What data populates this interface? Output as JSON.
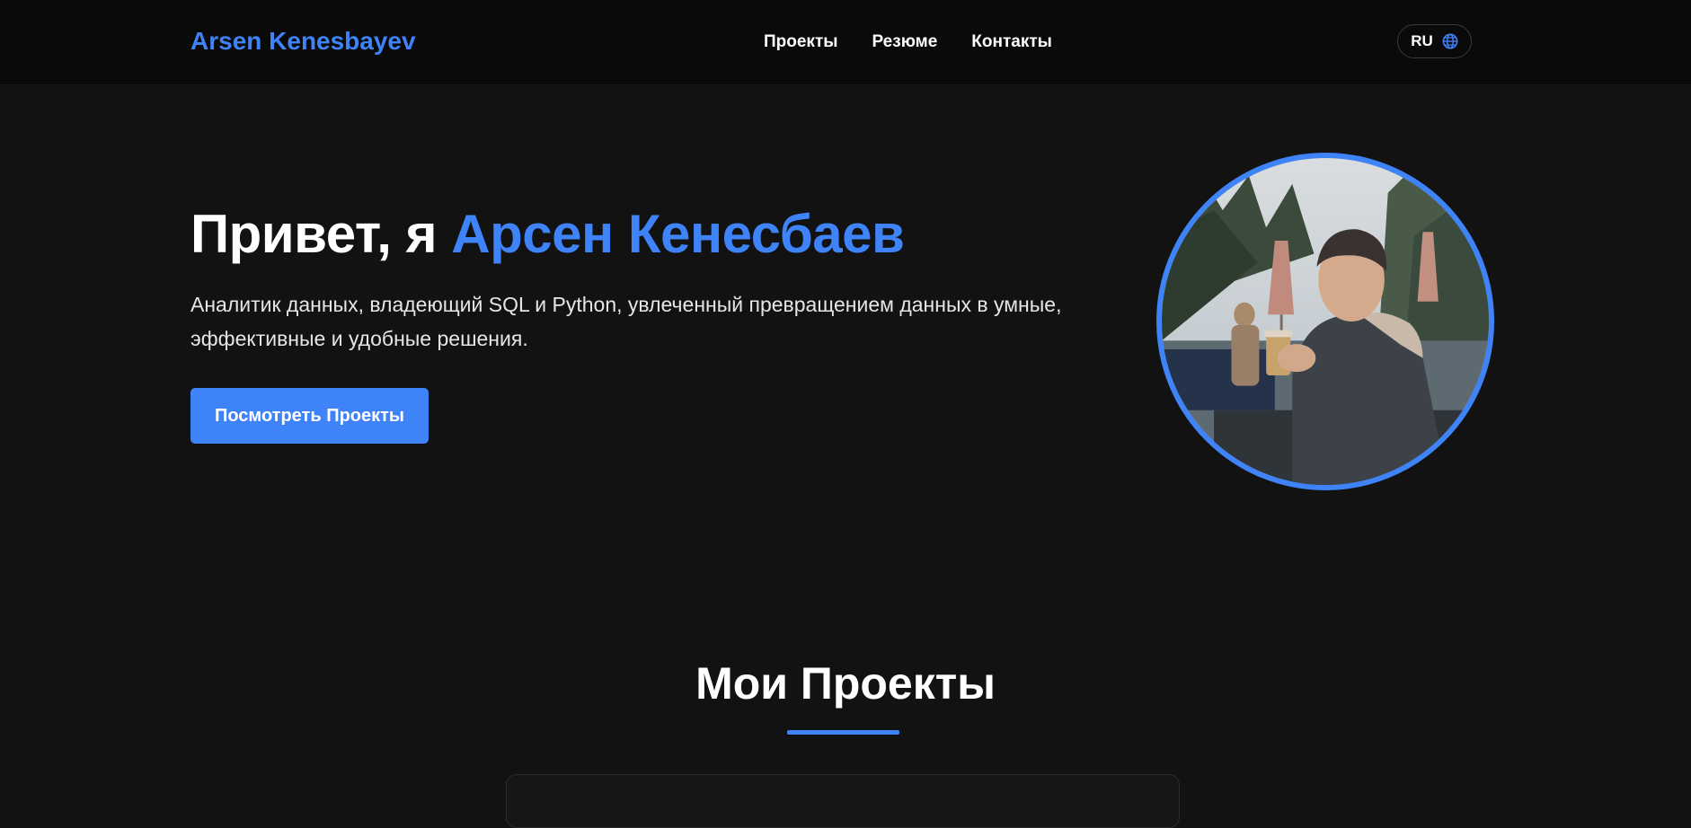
{
  "header": {
    "brand": "Arsen Kenesbayev",
    "nav": [
      {
        "label": "Проекты"
      },
      {
        "label": "Резюме"
      },
      {
        "label": "Контакты"
      }
    ],
    "language": {
      "label": "RU",
      "icon": "globe-icon"
    }
  },
  "hero": {
    "greeting": "Привет, я ",
    "name": "Арсен Кенесбаев",
    "subtitle": "Аналитик данных, владеющий SQL и Python, увлеченный превращением данных в умные, эффективные и удобные решения.",
    "cta_label": "Посмотреть Проекты",
    "avatar_icon": "profile-photo"
  },
  "projects": {
    "title": "Мои Проекты"
  },
  "colors": {
    "accent": "#3f83f8",
    "background": "#121212",
    "header_background": "#0a0a0a"
  }
}
